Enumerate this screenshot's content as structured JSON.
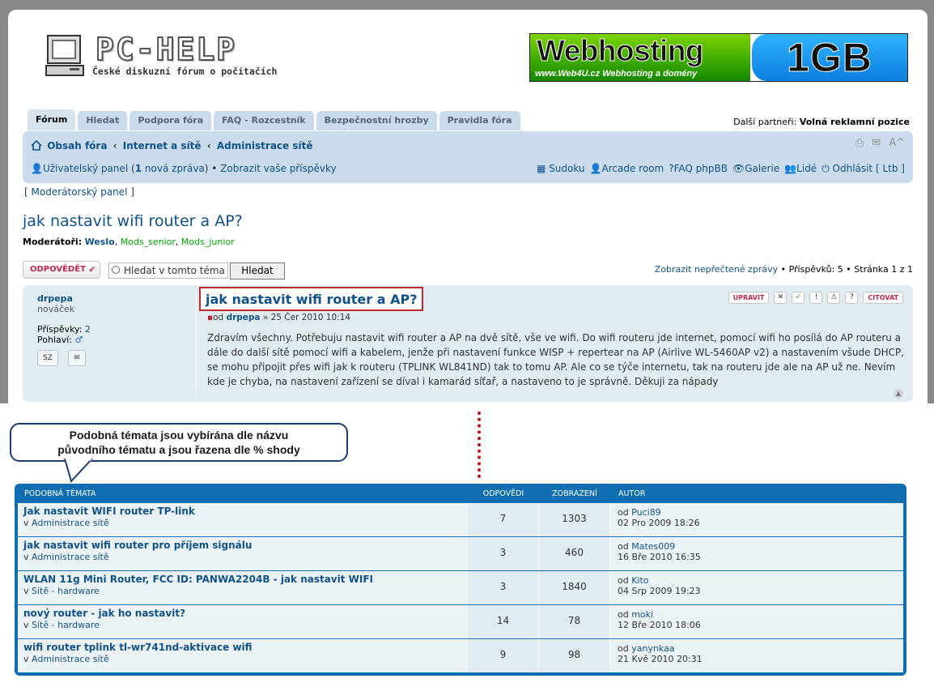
{
  "header": {
    "logo_text": "PC-HELP",
    "logo_subtitle": "České diskuzní fórum o počítačích",
    "banner_main": "Webhosting",
    "banner_sub": "www.Web4U.cz  Webhosting a domény",
    "banner_size": "1GB"
  },
  "tabs": [
    {
      "label": "Fórum"
    },
    {
      "label": "Hledat"
    },
    {
      "label": "Podpora fóra"
    },
    {
      "label": "FAQ - Rozcestník"
    },
    {
      "label": "Bezpečnostní hrozby"
    },
    {
      "label": "Pravidla fóra"
    }
  ],
  "partners": {
    "label": "Další partneři:",
    "value": "Volná reklamní pozice"
  },
  "breadcrumbs": [
    "Obsah fóra",
    "Internet a sítě",
    "Administrace sítě"
  ],
  "nav_tools": {
    "font_size": "A^"
  },
  "user_nav": {
    "panel_label": "Uživatelský panel",
    "new_messages": "1",
    "new_messages_label": "nová zpráva",
    "show_posts": "Zobrazit vaše příspěvky"
  },
  "right_links": [
    "Sudoku",
    "Arcade room",
    "FAQ phpBB",
    "Galerie",
    "Lidé",
    "Odhlásit [ Ltb ]"
  ],
  "mod_panel": "Moderátorský panel",
  "topic": {
    "title": "jak nastavit wifi router a AP?",
    "moderators_label": "Moderátoři:",
    "moderators": [
      "Weslo",
      "Mods_senior",
      "Mods_junior"
    ]
  },
  "actions": {
    "reply": "ODPOVĚDĚT",
    "search_value": "Hledat v tomto téma",
    "search_button": "Hledat",
    "unread": "Zobrazit nepřečtené zprávy",
    "posts_count": "Příspěvků: 5",
    "page": "Stránka 1 z 1"
  },
  "post": {
    "author": "drpepa",
    "rank": "nováček",
    "posts_label": "Příspěvky:",
    "posts": "2",
    "gender_label": "Pohlaví:",
    "pm_label": "SZ",
    "title": "jak nastavit wifi router a AP?",
    "meta_prefix": "od",
    "meta_date": "» 25 Čer 2010 10:14",
    "edit": "UPRAVIT",
    "quote": "CITOVAT",
    "body": "Zdravím všechny. Potřebuju nastavit wifi router a AP na dvě sítě, vše ve wifi. Do wifi routeru jde internet, pomocí wifi ho posílá do AP routeru a dále do další sítě pomocí wifi a kabelem, jenže při nastavení funkce WISP + repertear na AP (Airlive WL-5460AP v2) a nastavením všude DHCP, se mohu připojit přes wifi jak k routeru (TPLINK WL841ND) tak to tomu AP. Ale co se týče internetu, tak na routeru jde ale na AP už ne. Nevím kde je chyba, na nastavení zařízení se díval i kamarád síťař, a nastaveno to je správně. Děkuji za nápady"
  },
  "callout": {
    "line1": "Podobná témata jsou vybírána dle názvu",
    "line2": "původního tématu a jsou řazena dle % shody"
  },
  "similar": {
    "headers": {
      "topics": "PODOBNÁ TÉMATA",
      "replies": "ODPOVĚDI",
      "views": "ZOBRAZENÍ",
      "author": "AUTOR"
    },
    "rows": [
      {
        "title": "Jak nastavit WIFI router TP-link",
        "forum": "Administrace sítě",
        "replies": "7",
        "views": "1303",
        "author": "Puci89",
        "date": "02 Pro 2009 18:26"
      },
      {
        "title": "jak nastavit wifi router pro příjem signálu",
        "forum": "Administrace sítě",
        "replies": "3",
        "views": "460",
        "author": "Mates009",
        "date": "16 Bře 2010 16:35"
      },
      {
        "title": "WLAN 11g Mini Router, FCC ID: PANWA2204B - jak nastavit WIFI",
        "forum": "Sítě - hardware",
        "replies": "3",
        "views": "1840",
        "author": "Kito",
        "date": "04 Srp 2009 19:23"
      },
      {
        "title": "nový router - jak ho nastavit?",
        "forum": "Sítě - hardware",
        "replies": "14",
        "views": "78",
        "author": "moki",
        "date": "12 Bře 2010 18:06"
      },
      {
        "title": "wifi router tplink tl-wr741nd-aktivace wifi",
        "forum": "Administrace sítě",
        "replies": "9",
        "views": "98",
        "author": "yanynkaa",
        "date": "21 Kvě 2010 20:31"
      }
    ],
    "in_label": "v",
    "by_label": "od"
  }
}
